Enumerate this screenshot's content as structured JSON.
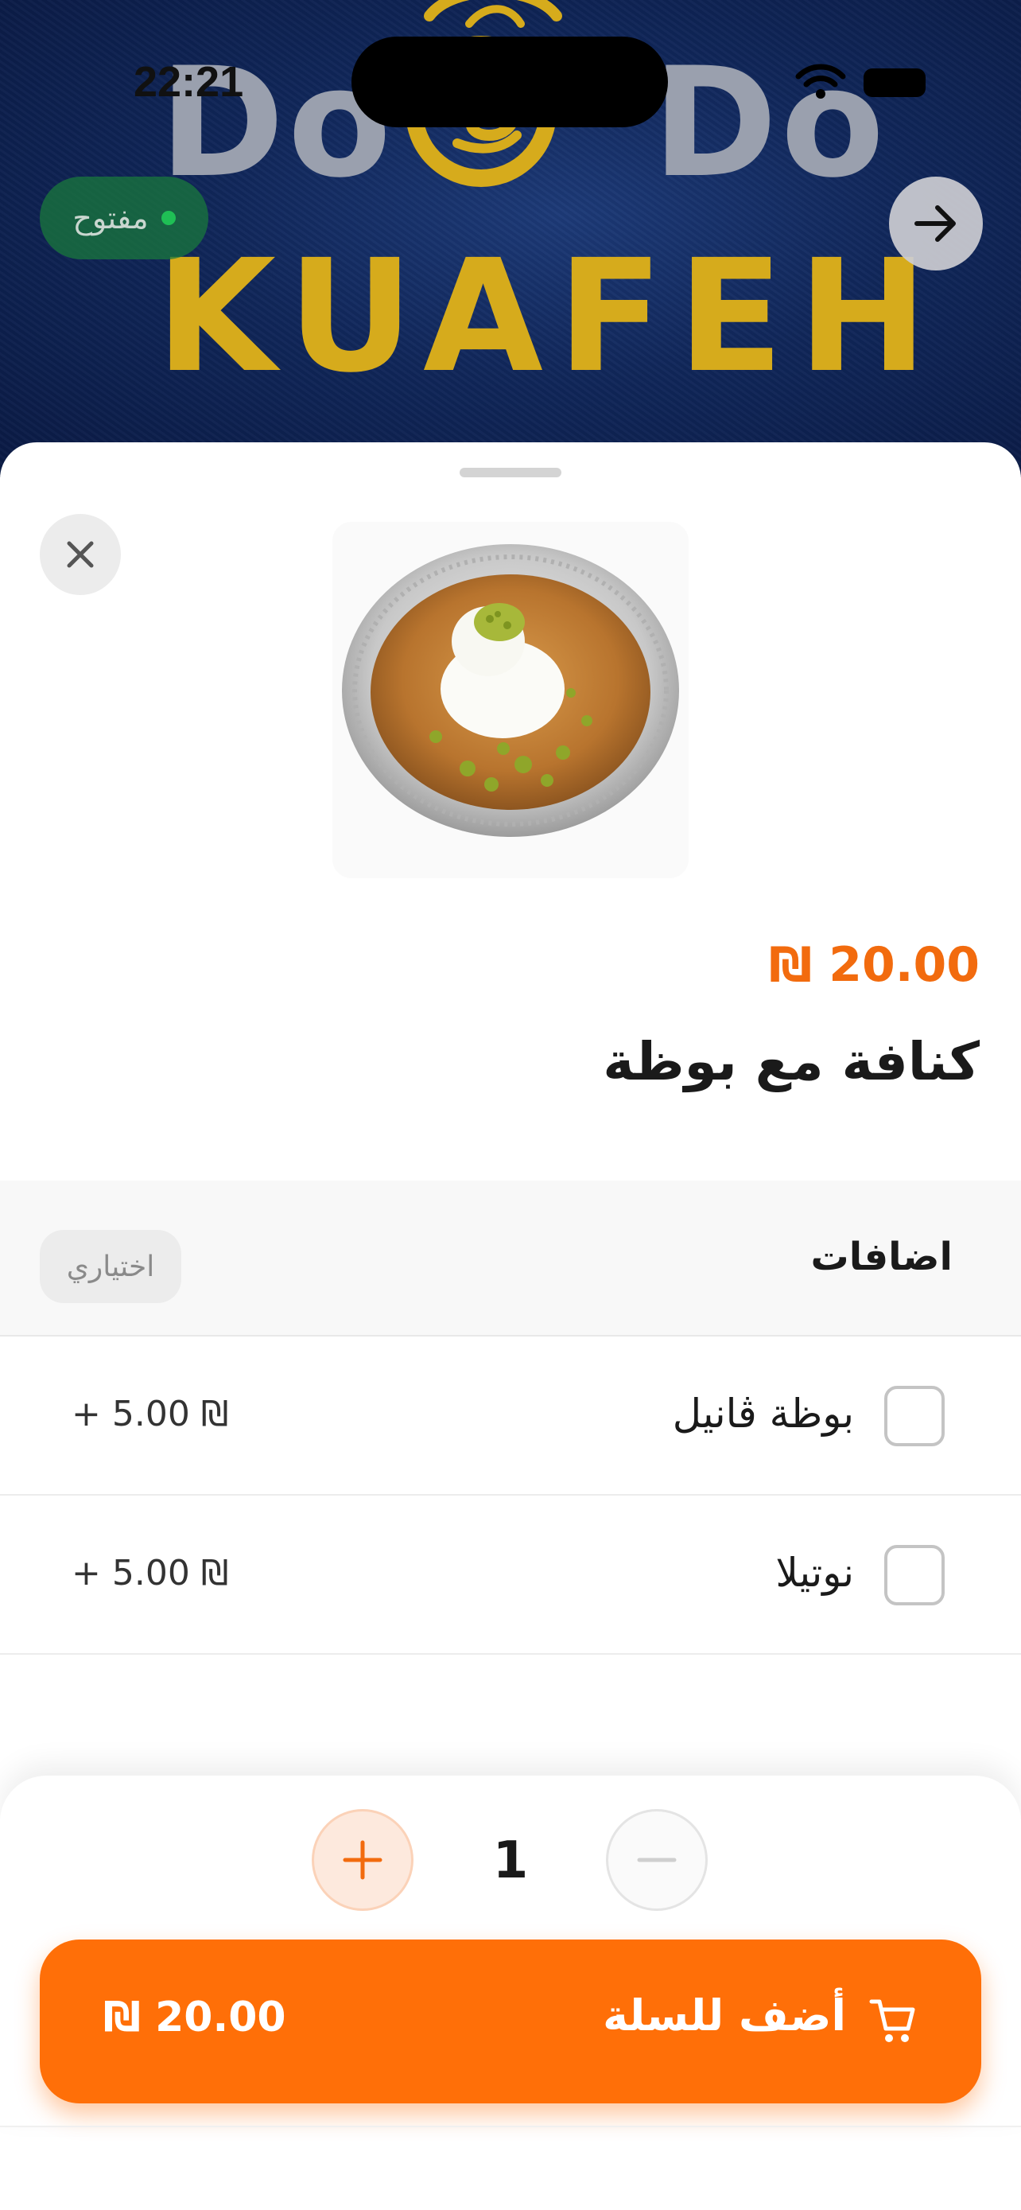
{
  "status_bar": {
    "time": "22:21"
  },
  "cover": {
    "logo_do_left": "Do",
    "logo_do_right": "Do",
    "logo_word": "KUAFEH",
    "open_status": "مفتوح",
    "colors": {
      "background": "#102659",
      "gold": "#d6ab1c",
      "open_dot": "#1fbf55"
    }
  },
  "product": {
    "price": "₪ 20.00",
    "name": "كنافة مع بوظة",
    "image_icon": "kunafa-dish-icon"
  },
  "addons": {
    "title": "اضافات",
    "optional_label": "اختياري",
    "items": [
      {
        "label": "بوظة ڤانيل",
        "price": "+ 5.00 ₪",
        "checked": false
      },
      {
        "label": "نوتيلا",
        "price": "+ 5.00 ₪",
        "checked": false
      }
    ]
  },
  "footer": {
    "quantity": "1",
    "add_to_cart_label": "أضف للسلة",
    "total": "₪ 20.00",
    "accent_color": "#ff6f08"
  }
}
